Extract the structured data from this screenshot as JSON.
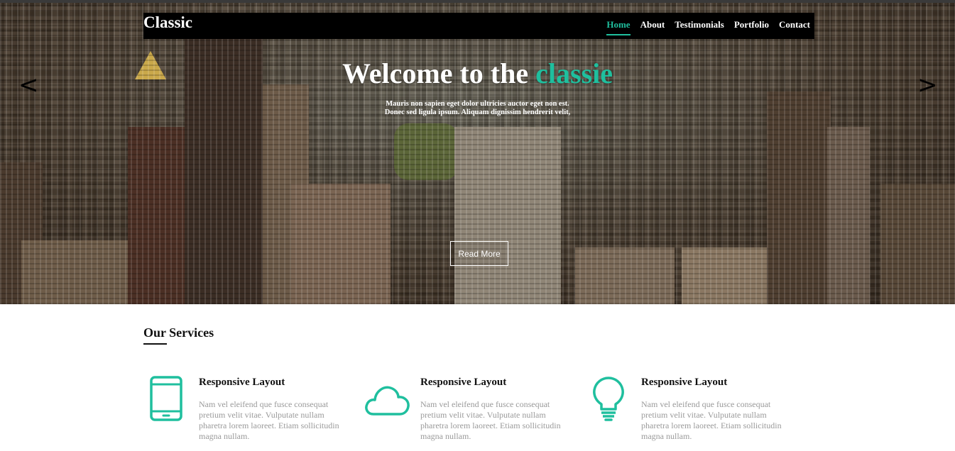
{
  "brand": "Classic",
  "nav": {
    "items": [
      "Home",
      "About",
      "Testimonials",
      "Portfolio",
      "Contact"
    ],
    "active": "Home"
  },
  "hero": {
    "title_main": "Welcome to the ",
    "title_accent": "classie",
    "subtitle_line1": "Mauris non sapien eget dolor ultricies auctor eget non est.",
    "subtitle_line2": "Donec sed ligula ipsum. Aliquam dignissim hendrerit velit,",
    "prev_arrow": "<",
    "next_arrow": ">",
    "cta": "Read More"
  },
  "services": {
    "title": "Our Services",
    "items": [
      {
        "icon": "mobile-phone-icon",
        "title": "Responsive Layout",
        "text": "Nam vel eleifend que fusce consequat pretium velit vitae. Vulputate nullam pharetra lorem laoreet. Etiam sollicitudin magna nullam."
      },
      {
        "icon": "cloud-icon",
        "title": "Responsive Layout",
        "text": "Nam vel eleifend que fusce consequat pretium velit vitae. Vulputate nullam pharetra lorem laoreet. Etiam sollicitudin magna nullam."
      },
      {
        "icon": "lightbulb-icon",
        "title": "Responsive Layout",
        "text": "Nam vel eleifend que fusce consequat pretium velit vitae. Vulputate nullam pharetra lorem laoreet. Etiam sollicitudin magna nullam."
      }
    ]
  },
  "colors": {
    "accent": "#1fbf9e",
    "navbar": "#000000",
    "body_text_muted": "#9a9a9a"
  }
}
